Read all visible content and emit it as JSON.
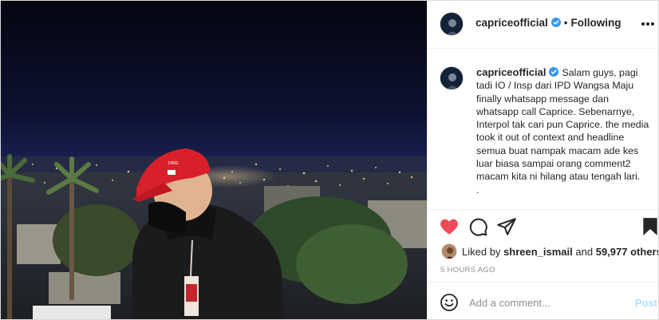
{
  "post": {
    "author": "capriceofficial",
    "separator": "•",
    "follow_state": "Following",
    "caption_author": "capriceofficial",
    "caption": "Salam guys, pagi tadi IO / Insp dari IPD Wangsa Maju finally whatsapp message dan whatsapp call Caprice. Sebenarnye, Interpol tak cari pun Caprice. the media took it out of context and headline semua buat nampak macam ade kes luar biasa sampai orang comment2 macam kita ni hilang atau tengah lari.",
    "caption_trailing": ".",
    "liked_by_prefix": "Liked by",
    "liked_by_user": "shreen_ismail",
    "liked_by_conjunction": "and",
    "liked_by_others": "59,977 others",
    "timestamp": "5 HOURS AGO",
    "liked": true
  },
  "comment": {
    "placeholder": "Add a comment...",
    "post_label": "Post"
  },
  "icons": {
    "more": "more-options-icon",
    "verified": "verified-badge-icon",
    "like": "heart-icon",
    "comment": "comment-icon",
    "share": "paper-plane-icon",
    "save": "bookmark-icon",
    "emoji": "emoji-icon"
  },
  "colors": {
    "like": "#ed4956",
    "verified": "#3897f0",
    "post_button": "#b2dffc"
  }
}
